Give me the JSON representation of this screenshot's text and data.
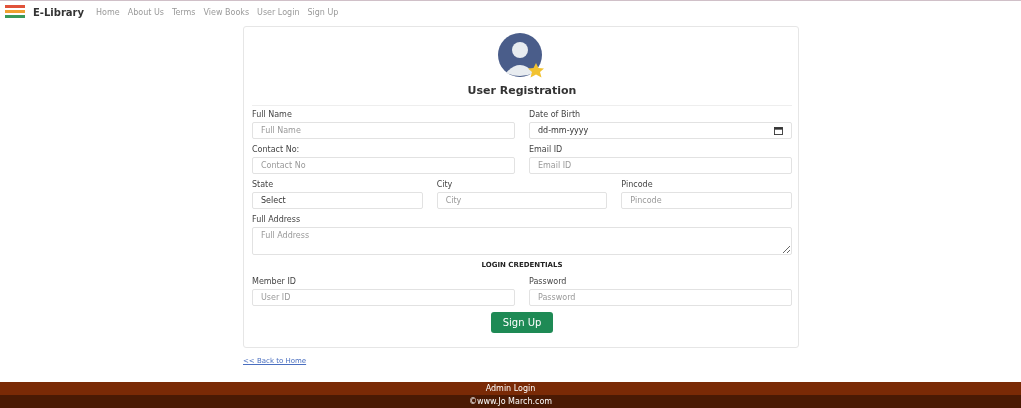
{
  "brand": "E-Library",
  "nav": [
    "Home",
    "About Us",
    "Terms",
    "View Books",
    "User Login",
    "Sign Up"
  ],
  "title": "User Registration",
  "rows": [
    [
      {
        "label": "Full Name",
        "kind": "text",
        "placeholder": "Full Name"
      },
      {
        "label": "Date of Birth",
        "kind": "date",
        "placeholder": "dd-mm-yyyy"
      }
    ],
    [
      {
        "label": "Contact No:",
        "kind": "text",
        "placeholder": "Contact No"
      },
      {
        "label": "Email ID",
        "kind": "text",
        "placeholder": "Email ID"
      }
    ],
    [
      {
        "label": "State",
        "kind": "select",
        "value": "Select"
      },
      {
        "label": "City",
        "kind": "text",
        "placeholder": "City"
      },
      {
        "label": "Pincode",
        "kind": "text",
        "placeholder": "Pincode"
      }
    ],
    [
      {
        "label": "Full Address",
        "kind": "textarea",
        "placeholder": "Full Address"
      }
    ]
  ],
  "section": "LOGIN CREDENTIALS",
  "login_rows": [
    [
      {
        "label": "Member ID",
        "kind": "text",
        "placeholder": "User ID"
      },
      {
        "label": "Password",
        "kind": "text",
        "placeholder": "Password"
      }
    ]
  ],
  "submit": "Sign Up",
  "back_link": "<< Back to Home",
  "footer": {
    "admin": "Admin Login",
    "copyright": "©www.Jo March.com"
  }
}
